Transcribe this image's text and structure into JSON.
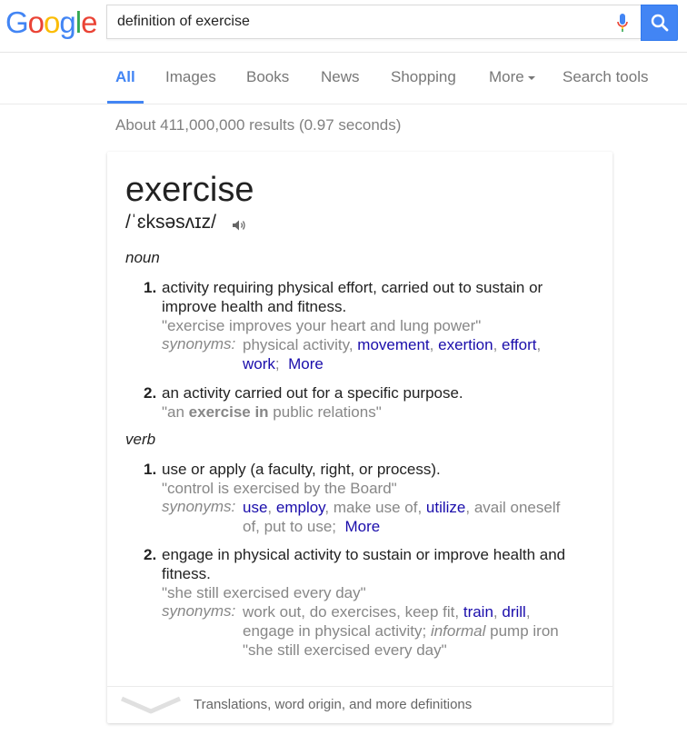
{
  "logo": {
    "letters": [
      "G",
      "o",
      "o",
      "g",
      "l",
      "e"
    ]
  },
  "search": {
    "query": "definition of exercise"
  },
  "tabs": [
    {
      "label": "All"
    },
    {
      "label": "Images"
    },
    {
      "label": "Books"
    },
    {
      "label": "News"
    },
    {
      "label": "Shopping"
    },
    {
      "label": "More"
    },
    {
      "label": "Search tools"
    }
  ],
  "stats": "About 411,000,000 results (0.97 seconds)",
  "card": {
    "word": "exercise",
    "phonetic": "/ˈɛksəsʌɪz/",
    "noun_label": "noun",
    "noun": [
      {
        "num": "1.",
        "def_line1": "activity requiring physical effort, carried out to sustain or",
        "def_line2": "improve health and fitness.",
        "example": "\"exercise improves your heart and lung power\"",
        "synonyms_label": "synonyms:",
        "syn_plain1": "physical activity, ",
        "syn_link1": "movement",
        "syn_link2": "exertion",
        "syn_link3": "effort",
        "syn_link4": "work",
        "syn_more": "More"
      },
      {
        "num": "2.",
        "def_line1": "an activity carried out for a specific purpose.",
        "example_pre": "\"an ",
        "example_bold": "exercise in",
        "example_post": " public relations\""
      }
    ],
    "verb_label": "verb",
    "verb": [
      {
        "num": "1.",
        "def_line1": "use or apply (a faculty, right, or process).",
        "example": "\"control is exercised by the Board\"",
        "synonyms_label": "synonyms:",
        "syn_link1": "use",
        "syn_link2": "employ",
        "syn_plain1": ", make use of, ",
        "syn_link3": "utilize",
        "syn_plain2": ", avail oneself",
        "syn_plain3": "of, put to use;",
        "syn_more": "More"
      },
      {
        "num": "2.",
        "def_line1": "engage in physical activity to sustain or improve health and",
        "def_line2": "fitness.",
        "example": "\"she still exercised every day\"",
        "synonyms_label": "synonyms:",
        "syn_plain1": "work out, do exercises, keep fit, ",
        "syn_link1": "train",
        "syn_link2": "drill",
        "syn_plain2": "engage in physical activity; ",
        "syn_informal": "informal",
        "syn_plain3": " pump iron",
        "syn_example": "\"she still exercised every day\""
      }
    ],
    "footer": "Translations, word origin, and more definitions"
  },
  "colors": {
    "blue": "#4285f4",
    "red": "#ea4335",
    "yellow": "#fbbc05",
    "green": "#34a853",
    "link": "#1a0dab"
  },
  "icons": [
    "mic-icon",
    "search-icon",
    "speaker-icon",
    "chevron-down-icon"
  ]
}
